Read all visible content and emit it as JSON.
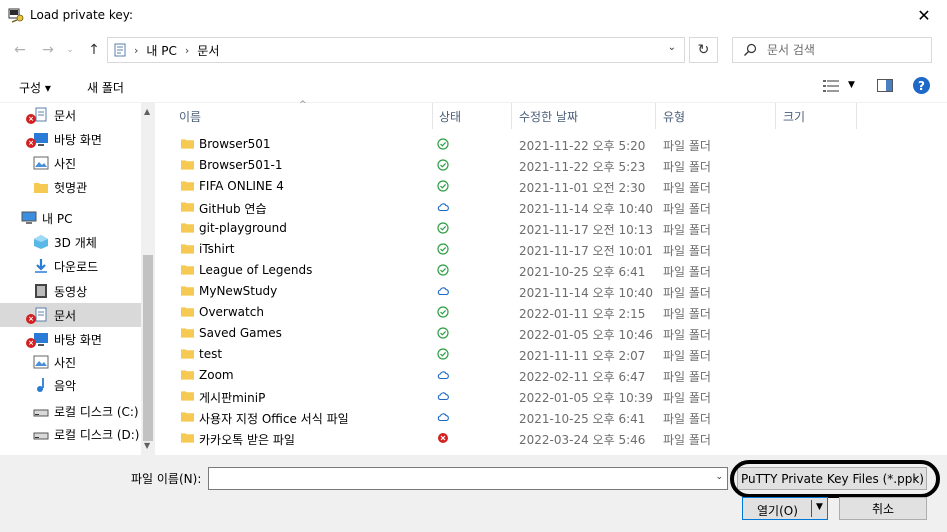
{
  "window": {
    "title": "Load private key:"
  },
  "nav": {
    "breadcrumb": [
      "내 PC",
      "문서"
    ],
    "search_placeholder": "문서 검색"
  },
  "toolbar": {
    "organize_label": "구성 ▾",
    "new_folder_label": "새 폴더"
  },
  "sidebar": {
    "items": [
      {
        "label": "문서",
        "icon": "documents-icon",
        "error": true
      },
      {
        "label": "바탕 화면",
        "icon": "desktop-icon",
        "error": true
      },
      {
        "label": "사진",
        "icon": "pictures-icon",
        "error": false
      },
      {
        "label": "헛명관",
        "icon": "folder-icon",
        "error": false
      },
      {
        "label": "내 PC",
        "icon": "pc-icon",
        "error": false
      },
      {
        "label": "3D 개체",
        "icon": "3d-objects-icon",
        "error": false
      },
      {
        "label": "다운로드",
        "icon": "downloads-icon",
        "error": false
      },
      {
        "label": "동영상",
        "icon": "videos-icon",
        "error": false
      },
      {
        "label": "문서",
        "icon": "documents-icon",
        "error": true,
        "selected": true
      },
      {
        "label": "바탕 화면",
        "icon": "desktop-icon",
        "error": true
      },
      {
        "label": "사진",
        "icon": "pictures-icon",
        "error": false
      },
      {
        "label": "음악",
        "icon": "music-icon",
        "error": false
      },
      {
        "label": "로컬 디스크 (C:)",
        "icon": "drive-icon",
        "error": false
      },
      {
        "label": "로컬 디스크 (D:)",
        "icon": "drive-icon",
        "error": false
      }
    ]
  },
  "columns": {
    "name": "이름",
    "status": "상태",
    "modified": "수정한 날짜",
    "type": "유형",
    "size": "크기"
  },
  "files": [
    {
      "name": "Browser501",
      "status": "synced",
      "date": "2021-11-22 오후 5:20",
      "type": "파일 폴더"
    },
    {
      "name": "Browser501-1",
      "status": "synced",
      "date": "2021-11-22 오후 5:23",
      "type": "파일 폴더"
    },
    {
      "name": "FIFA ONLINE 4",
      "status": "synced",
      "date": "2021-11-01 오전 2:30",
      "type": "파일 폴더"
    },
    {
      "name": "GitHub 연습",
      "status": "cloud",
      "date": "2021-11-14 오후 10:40",
      "type": "파일 폴더"
    },
    {
      "name": "git-playground",
      "status": "synced",
      "date": "2021-11-17 오전 10:13",
      "type": "파일 폴더"
    },
    {
      "name": "iTshirt",
      "status": "synced",
      "date": "2021-11-17 오전 10:01",
      "type": "파일 폴더"
    },
    {
      "name": "League of Legends",
      "status": "synced",
      "date": "2021-10-25 오후 6:41",
      "type": "파일 폴더"
    },
    {
      "name": "MyNewStudy",
      "status": "cloud",
      "date": "2021-11-14 오후 10:40",
      "type": "파일 폴더"
    },
    {
      "name": "Overwatch",
      "status": "synced",
      "date": "2022-01-11 오후 2:15",
      "type": "파일 폴더"
    },
    {
      "name": "Saved Games",
      "status": "synced",
      "date": "2022-01-05 오후 10:46",
      "type": "파일 폴더"
    },
    {
      "name": "test",
      "status": "synced",
      "date": "2021-11-11 오후 2:07",
      "type": "파일 폴더"
    },
    {
      "name": "Zoom",
      "status": "cloud",
      "date": "2022-02-11 오후 6:47",
      "type": "파일 폴더"
    },
    {
      "name": "게시판miniP",
      "status": "cloud",
      "date": "2022-01-05 오후 10:39",
      "type": "파일 폴더"
    },
    {
      "name": "사용자 지정 Office 서식 파일",
      "status": "cloud",
      "date": "2021-10-25 오후 6:41",
      "type": "파일 폴더"
    },
    {
      "name": "카카오톡 받은 파일",
      "status": "error",
      "date": "2022-03-24 오후 5:46",
      "type": "파일 폴더"
    }
  ],
  "footer": {
    "filename_label": "파일 이름(N):",
    "filename_value": "",
    "filter_label": "PuTTY Private Key Files (*.ppk)",
    "open_label": "열기(O)",
    "cancel_label": "취소"
  },
  "colors": {
    "synced": "#2e9e44",
    "cloud": "#1e68c7",
    "error": "#d42020",
    "folder": "#f6c952",
    "selected": "#d9d9d9"
  }
}
